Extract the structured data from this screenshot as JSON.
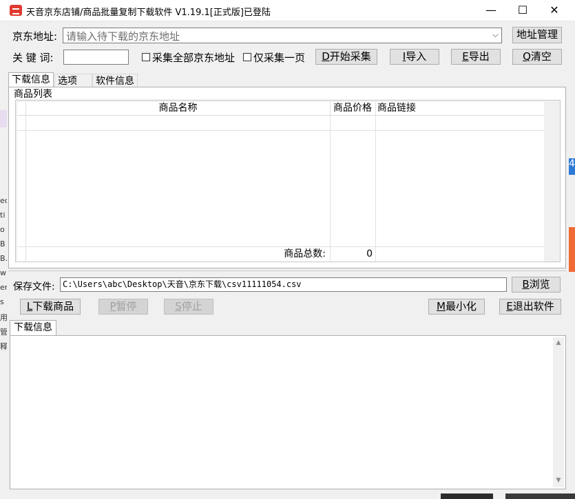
{
  "window": {
    "title": "天音京东店铺/商品批量复制下载软件 V1.19.1[正式版]已登陆",
    "minimize": "—",
    "maximize": "☐",
    "close": "✕"
  },
  "search": {
    "address_label": "京东地址:",
    "address_placeholder": "请输入待下载的京东地址",
    "address_manage": "地址管理",
    "keyword_label": "关 键 词:",
    "keyword_value": "",
    "collect_all_label": "采集全部京东地址",
    "collect_one_page_label": "仅采集一页",
    "start_hotkey": "D",
    "start_label": "开始采集",
    "import_hotkey": "I",
    "import_label": "导入",
    "export_hotkey": "E",
    "export_label": "导出",
    "clear_hotkey": "Q",
    "clear_label": "清空"
  },
  "tabs": [
    "下载信息",
    "选项",
    "软件信息"
  ],
  "products": {
    "group_title": "商品列表",
    "columns": [
      "商品名称",
      "商品价格",
      "商品链接"
    ],
    "total_label": "商品总数:",
    "total_value": "0"
  },
  "save": {
    "label": "保存文件:",
    "path": "C:\\Users\\abc\\Desktop\\天音\\京东下载\\csv11111054.csv",
    "browse_hotkey": "B",
    "browse_label": "浏览"
  },
  "actions": {
    "download_hotkey": "L",
    "download_label": "下载商品",
    "pause_hotkey": "P",
    "pause_label": "暂停",
    "stop_hotkey": "S",
    "stop_label": "停止",
    "minimize_hotkey": "M",
    "minimize_label": "最小化",
    "exit_hotkey": "E",
    "exit_label": "退出软件"
  },
  "log": {
    "tab_label": "下载信息"
  },
  "left_fragments": [
    "ec",
    "ti",
    "o",
    "B",
    "B.",
    "w",
    "er",
    "s",
    "用",
    "管",
    "释"
  ],
  "accent_colors": {
    "app_icon": "#e03a2f",
    "orange_strip": "#f06a35",
    "blue_badge": "#2d7ad6"
  }
}
